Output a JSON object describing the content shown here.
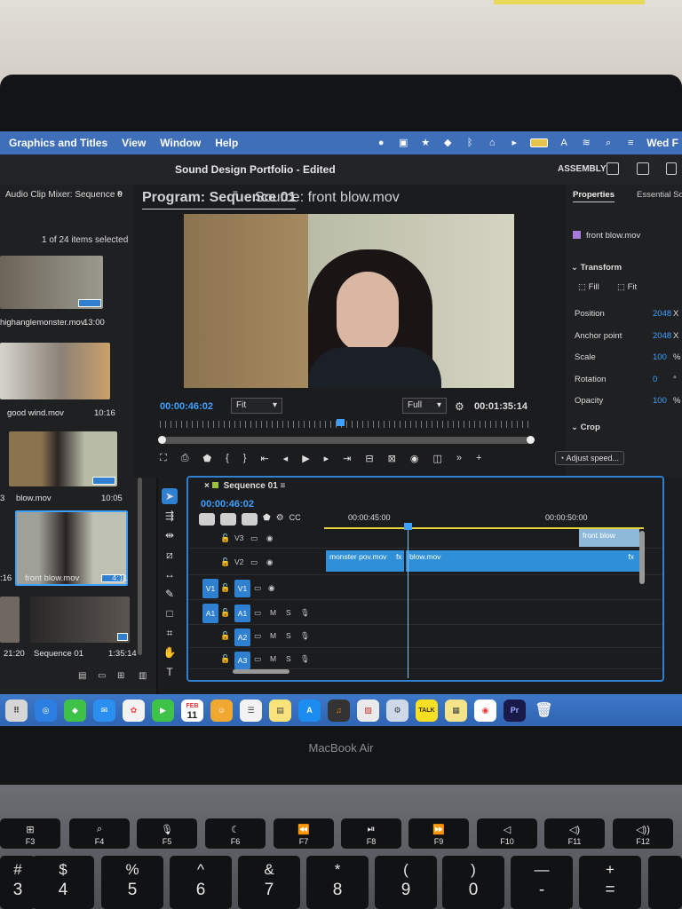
{
  "menubar": {
    "items": [
      "Graphics and Titles",
      "View",
      "Window",
      "Help"
    ],
    "clock": "Wed F"
  },
  "app": {
    "title": "Sound Design Portfolio - Edited",
    "workspace": "ASSEMBLY"
  },
  "project": {
    "panel_title": "Audio Clip Mixer: Sequence 0",
    "selection": "1 of 24 items selected",
    "clips": [
      {
        "name": "highanglemonster.mov",
        "duration": "13:00"
      },
      {
        "name": "good wind.mov",
        "duration": "10:16"
      },
      {
        "name": "blow.mov",
        "duration": "10:05"
      },
      {
        "name": "front blow.mov",
        "duration": "4:11"
      },
      {
        "name": "Sequence 01",
        "duration": "1:35:14"
      }
    ],
    "left_times": [
      "3",
      ":16",
      "21:20"
    ]
  },
  "monitor": {
    "tab_program": "Program: Sequence 01",
    "tab_source": "Source: front blow.mov",
    "current_time": "00:00:46:02",
    "fit_select": "Fit",
    "quality_select": "Full",
    "duration": "00:01:35:14"
  },
  "properties": {
    "tab": "Properties",
    "tab2": "Essential Sou",
    "clip_name": "front blow.mov",
    "transform_label": "Transform",
    "fill_label": "Fill",
    "fit_label": "Fit",
    "rows": [
      {
        "label": "Position",
        "value": "2048",
        "unit": "X"
      },
      {
        "label": "Anchor point",
        "value": "2048",
        "unit": "X"
      },
      {
        "label": "Scale",
        "value": "100",
        "unit": "%"
      },
      {
        "label": "Rotation",
        "value": "0",
        "unit": "°"
      },
      {
        "label": "Opacity",
        "value": "100",
        "unit": "%"
      }
    ],
    "crop_label": "Crop",
    "adjust_speed": "Adjust speed..."
  },
  "timeline": {
    "title": "Sequence 01",
    "current_time": "00:00:46:02",
    "ruler_marks": [
      "00:00:45:00",
      "00:00:50:00"
    ],
    "tracks": {
      "v3": "V3",
      "v2": "V2",
      "v1": "V1",
      "a1": "A1",
      "a2": "A2",
      "a3": "A3"
    },
    "source_v1": "V1",
    "source_a1": "A1",
    "mute": "M",
    "solo": "S",
    "clips": {
      "monster": "monster pov.mov",
      "blow": "blow.mov",
      "front": "front blow",
      "fx": "fx"
    }
  },
  "dock": {
    "calendar_month": "FEB",
    "calendar_day": "11",
    "talk": "TALK",
    "premiere": "Pr"
  },
  "hardware": {
    "model": "MacBook Air"
  },
  "keyboard": {
    "fn_row": [
      "F3",
      "F4",
      "F5",
      "F6",
      "F7",
      "F8",
      "F9",
      "F10",
      "F11",
      "F12"
    ],
    "num_row": [
      {
        "top": "#",
        "bot": "3"
      },
      {
        "top": "$",
        "bot": "4"
      },
      {
        "top": "%",
        "bot": "5"
      },
      {
        "top": "^",
        "bot": "6"
      },
      {
        "top": "&",
        "bot": "7"
      },
      {
        "top": "*",
        "bot": "8"
      },
      {
        "top": "(",
        "bot": "9"
      },
      {
        "top": ")",
        "bot": "0"
      },
      {
        "top": "—",
        "bot": "-"
      },
      {
        "top": "+",
        "bot": "="
      }
    ]
  },
  "colors": {
    "accent": "#2f80d1",
    "timecode": "#3ea0ff",
    "menubar": "#3f6fb8"
  }
}
